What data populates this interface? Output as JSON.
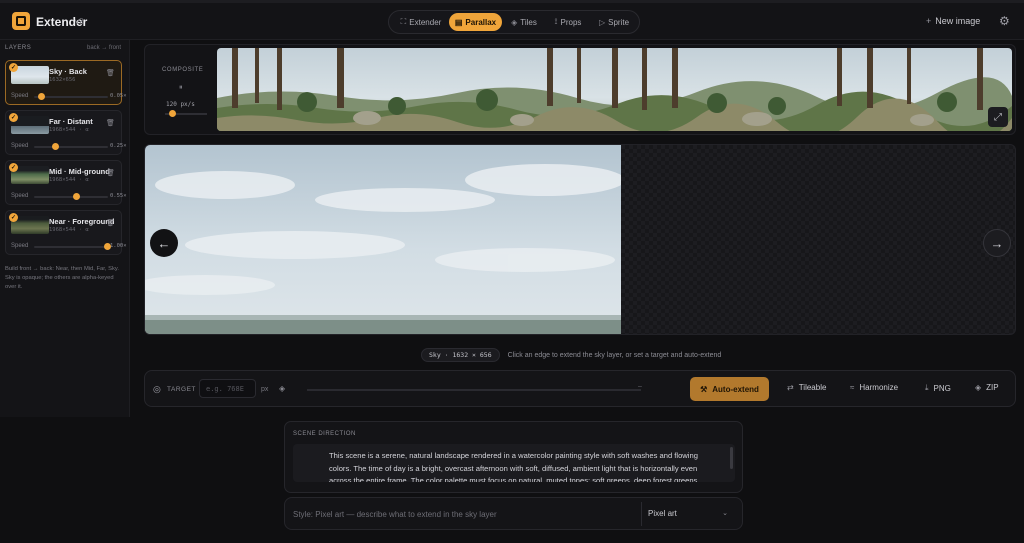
{
  "app": {
    "name": "Extender",
    "version": "v2"
  },
  "modes": [
    {
      "label": "Extender",
      "glyph": "⛶"
    },
    {
      "label": "Parallax",
      "glyph": "▤"
    },
    {
      "label": "Tiles",
      "glyph": "◈"
    },
    {
      "label": "Props",
      "glyph": "⟟"
    },
    {
      "label": "Sprite",
      "glyph": "▷"
    }
  ],
  "header": {
    "new_image": "New image"
  },
  "layers": {
    "heading": "LAYERS",
    "order": "back → front",
    "speed_label": "Speed",
    "items": [
      {
        "name": "Sky · Back",
        "dims": "1632×656",
        "speed": "0.05×",
        "speed_value": 0.05
      },
      {
        "name": "Far · Distant",
        "dims": "1968×544 · α",
        "speed": "0.25×",
        "speed_value": 0.25
      },
      {
        "name": "Mid · Mid-ground",
        "dims": "1968×544 · α",
        "speed": "0.55×",
        "speed_value": 0.55
      },
      {
        "name": "Near · Foreground",
        "dims": "1968×544 · α",
        "speed": "1.00×",
        "speed_value": 1.0
      }
    ],
    "note": "Build front → back: Near, then Mid, Far, Sky. Sky is opaque; the others are alpha-keyed over it."
  },
  "composite": {
    "label": "COMPOSITE",
    "rate": "120 px/s"
  },
  "status": {
    "chip": "Sky · 1632 × 656",
    "hint": "Click an edge to extend the sky layer, or set a target and auto-extend"
  },
  "toolbar": {
    "target_label": "TARGET",
    "target_placeholder": "e.g. 768E",
    "unit": "px",
    "auto_extend": "Auto-extend",
    "tileable": "Tileable",
    "harmonize": "Harmonize",
    "png": "PNG",
    "zip": "ZIP"
  },
  "scene": {
    "label": "SCENE DIRECTION",
    "text": "This scene is a serene, natural landscape rendered in a watercolor painting style with soft washes and flowing colors. The time of day is a bright, overcast afternoon with soft, diffused, ambient light that is horizontally even across the entire frame. The color palette must focus on natural, muted tones: soft greens, deep forest greens"
  },
  "style": {
    "placeholder": "Style: Pixel art — describe what to extend in the sky layer",
    "selected": "Pixel art"
  }
}
